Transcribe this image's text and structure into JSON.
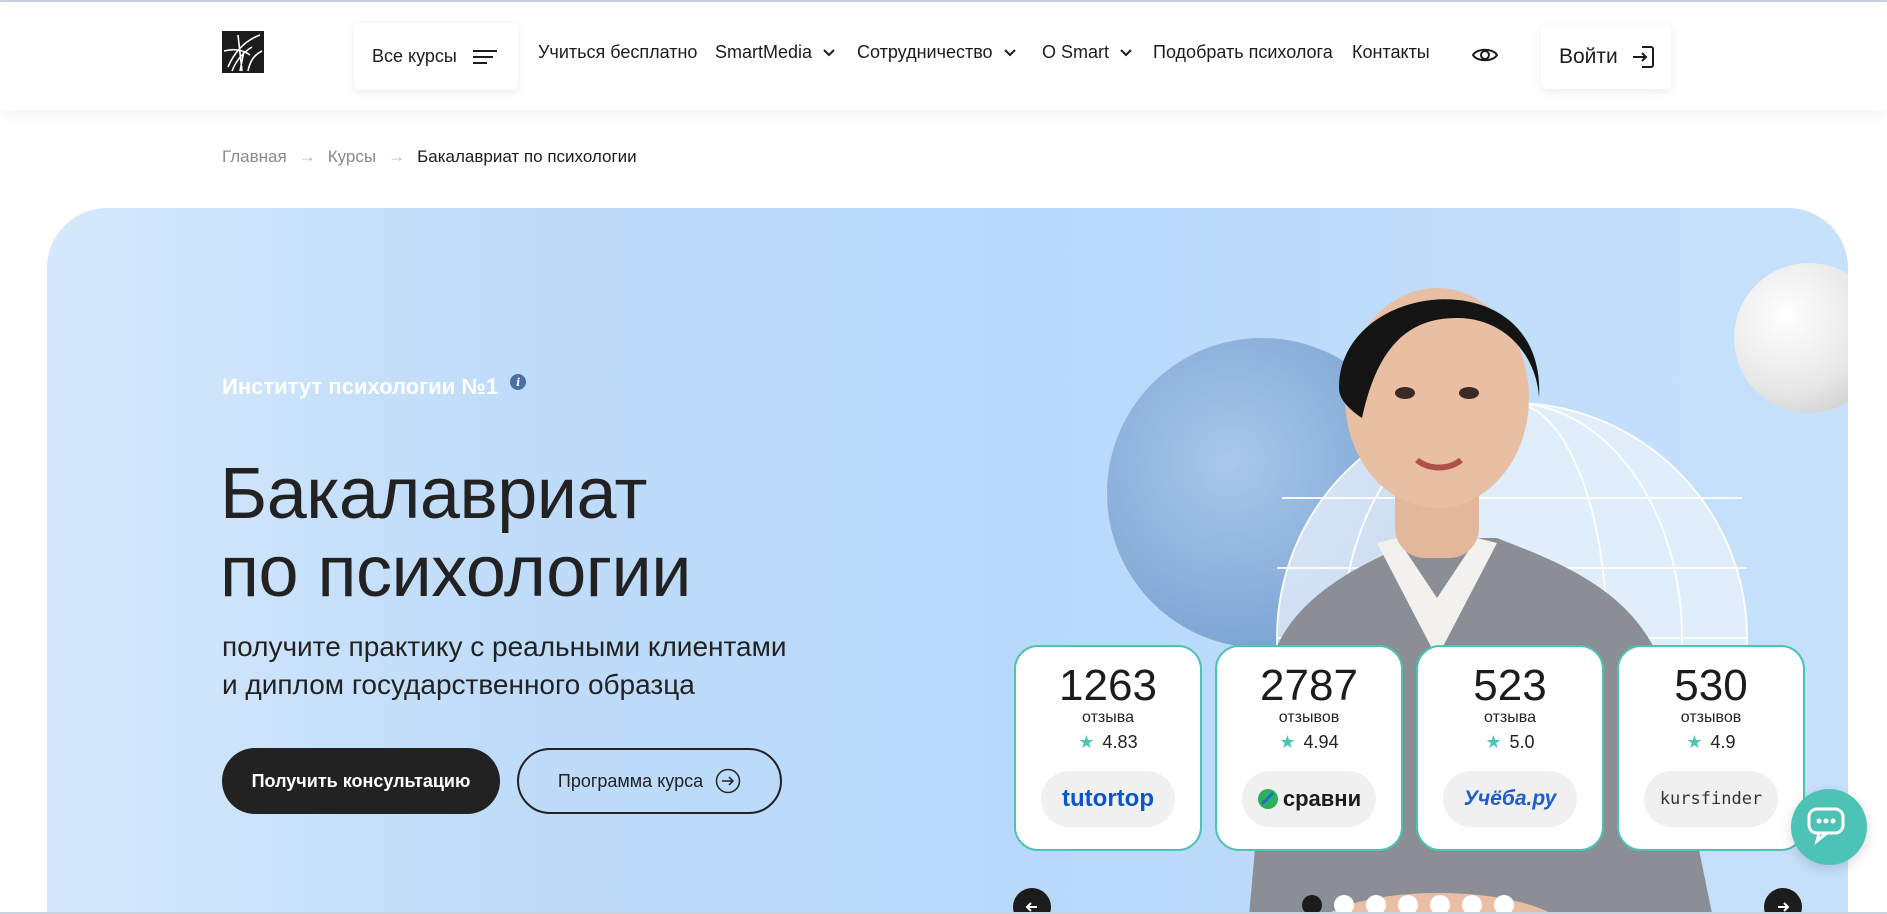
{
  "header": {
    "all_courses_label": "Все курсы",
    "nav": [
      {
        "label": "Учиться бесплатно",
        "dropdown": false
      },
      {
        "label": "SmartMedia",
        "dropdown": true
      },
      {
        "label": "Сотрудничество",
        "dropdown": true
      },
      {
        "label": "О Smart",
        "dropdown": true
      },
      {
        "label": "Подобрать психолога",
        "dropdown": false
      },
      {
        "label": "Контакты",
        "dropdown": false
      }
    ],
    "login_label": "Войти"
  },
  "breadcrumb": {
    "items": [
      "Главная",
      "Курсы"
    ],
    "separator": "→",
    "current": "Бакалавриат по психологии"
  },
  "hero": {
    "badge": "Институт психологии №1",
    "title_line1": "Бакалавриат",
    "title_line2": "по психологии",
    "subtitle_line1": "получите практику с реальными клиентами",
    "subtitle_line2": "и диплом государственного образца",
    "primary_button": "Получить консультацию",
    "secondary_button": "Программа курса"
  },
  "review_cards": [
    {
      "count": "1263",
      "label": "отзыва",
      "rating": "4.83",
      "platform": "tutortop",
      "color": "#0a55c8"
    },
    {
      "count": "2787",
      "label": "отзывов",
      "rating": "4.94",
      "platform": "сравни",
      "color": "#1c1c1c"
    },
    {
      "count": "523",
      "label": "отзыва",
      "rating": "5.0",
      "platform": "Учёба.ру",
      "color": "#1d5fd0"
    },
    {
      "count": "530",
      "label": "отзывов",
      "rating": "4.9",
      "platform": "kursfinder",
      "color": "#333333"
    }
  ],
  "carousel": {
    "dot_count": 7,
    "active_index": 0
  },
  "colors": {
    "accent": "#4cc3b5",
    "dark": "#1c1c1c",
    "hero_bg": "#b8d9fb"
  }
}
